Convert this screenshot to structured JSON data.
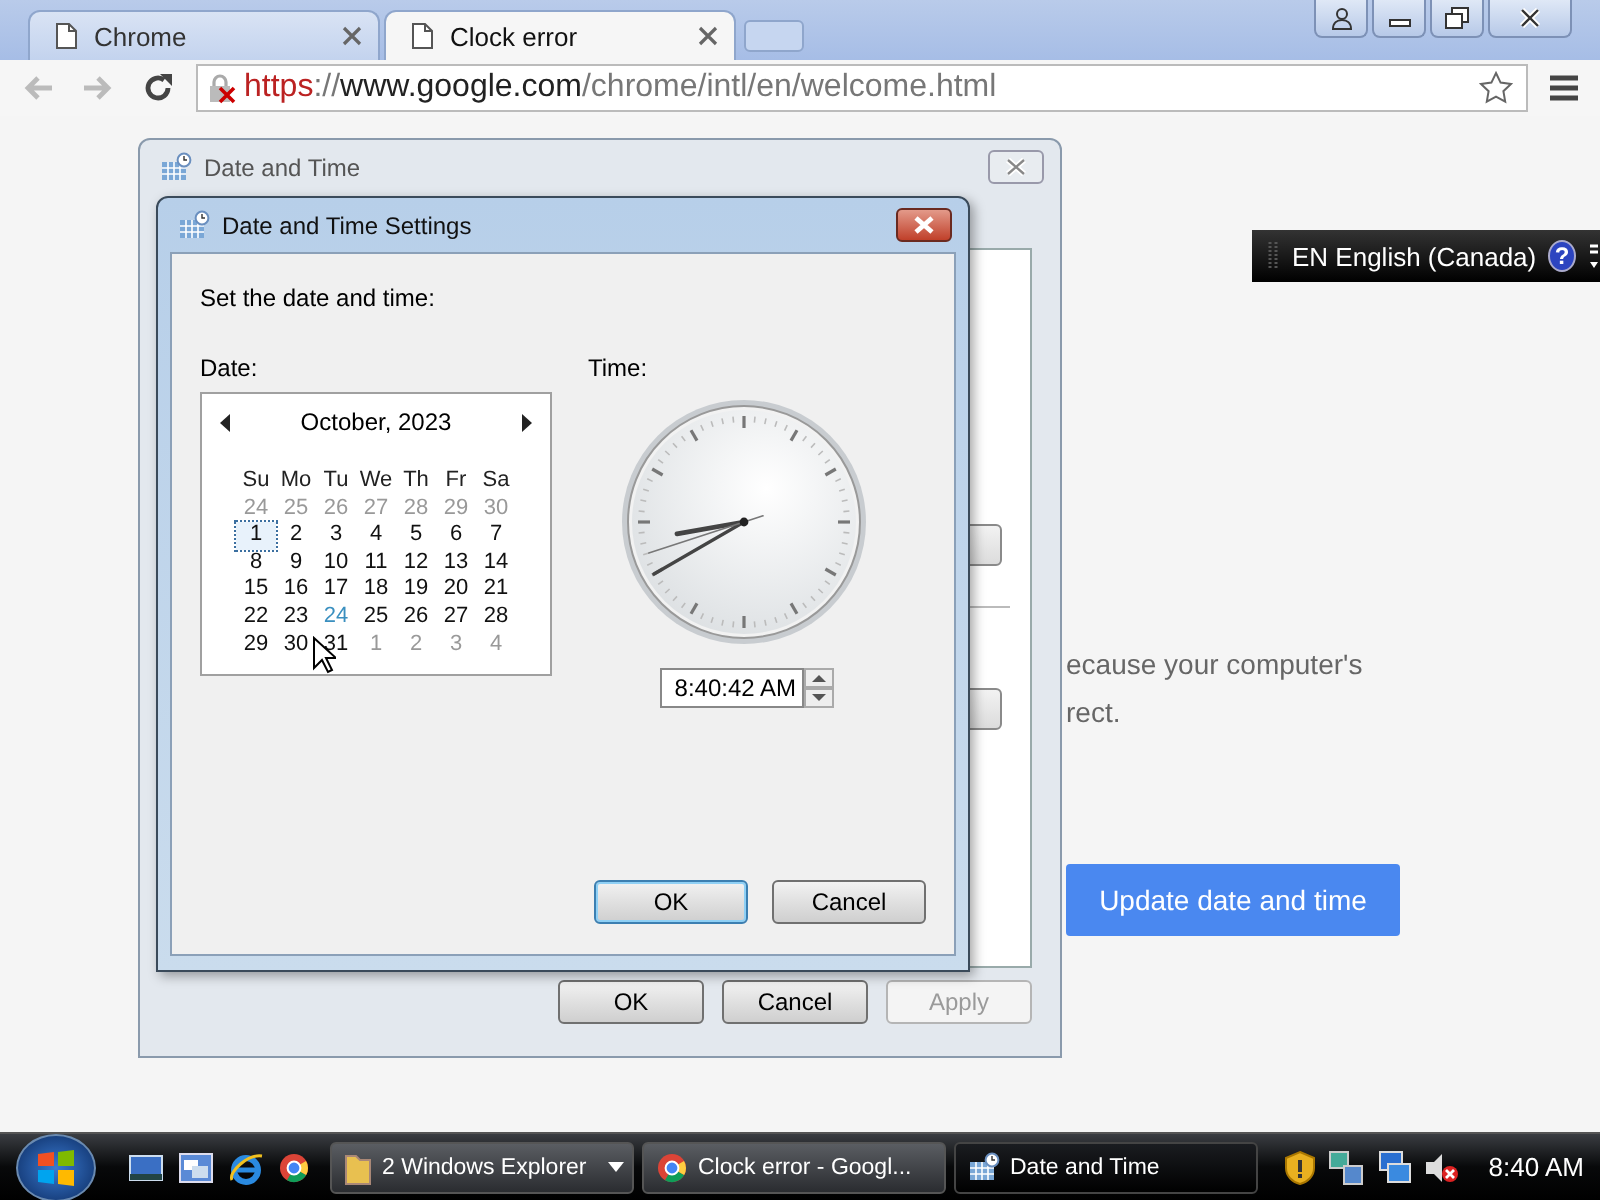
{
  "browser": {
    "tabs": [
      {
        "title": "Chrome",
        "selected": false
      },
      {
        "title": "Clock error",
        "selected": true
      }
    ],
    "address": {
      "scheme": "https",
      "separator": "://",
      "host": "www.google.com",
      "path": "/chrome/intl/en/welcome.html",
      "secure": false
    },
    "page": {
      "lines": [
        "ecause your computer's",
        "rect."
      ],
      "button": "Update date and time"
    }
  },
  "language_bar": {
    "label": "EN English (Canada)",
    "help": "?"
  },
  "date_time_window": {
    "title": "Date and Time",
    "buttons": [
      {
        "label": "OK",
        "disabled": false
      },
      {
        "label": "Cancel",
        "disabled": false
      },
      {
        "label": "Apply",
        "disabled": true
      }
    ]
  },
  "settings_dialog": {
    "title": "Date and Time Settings",
    "prompt": "Set the date and time:",
    "date_label": "Date:",
    "time_label": "Time:",
    "calendar": {
      "month": "October, 2023",
      "weekdays": [
        "Su",
        "Mo",
        "Tu",
        "We",
        "Th",
        "Fr",
        "Sa"
      ],
      "days": [
        {
          "day": "24",
          "other": true,
          "selected": false,
          "today": false
        },
        {
          "day": "25",
          "other": true,
          "selected": false,
          "today": false
        },
        {
          "day": "26",
          "other": true,
          "selected": false,
          "today": false
        },
        {
          "day": "27",
          "other": true,
          "selected": false,
          "today": false
        },
        {
          "day": "28",
          "other": true,
          "selected": false,
          "today": false
        },
        {
          "day": "29",
          "other": true,
          "selected": false,
          "today": false
        },
        {
          "day": "30",
          "other": true,
          "selected": false,
          "today": false
        },
        {
          "day": "1",
          "other": false,
          "selected": true,
          "today": false
        },
        {
          "day": "2",
          "other": false,
          "selected": false,
          "today": false
        },
        {
          "day": "3",
          "other": false,
          "selected": false,
          "today": false
        },
        {
          "day": "4",
          "other": false,
          "selected": false,
          "today": false
        },
        {
          "day": "5",
          "other": false,
          "selected": false,
          "today": false
        },
        {
          "day": "6",
          "other": false,
          "selected": false,
          "today": false
        },
        {
          "day": "7",
          "other": false,
          "selected": false,
          "today": false
        },
        {
          "day": "8",
          "other": false,
          "selected": false,
          "today": false
        },
        {
          "day": "9",
          "other": false,
          "selected": false,
          "today": false
        },
        {
          "day": "10",
          "other": false,
          "selected": false,
          "today": false
        },
        {
          "day": "11",
          "other": false,
          "selected": false,
          "today": false
        },
        {
          "day": "12",
          "other": false,
          "selected": false,
          "today": false
        },
        {
          "day": "13",
          "other": false,
          "selected": false,
          "today": false
        },
        {
          "day": "14",
          "other": false,
          "selected": false,
          "today": false
        },
        {
          "day": "15",
          "other": false,
          "selected": false,
          "today": false
        },
        {
          "day": "16",
          "other": false,
          "selected": false,
          "today": false
        },
        {
          "day": "17",
          "other": false,
          "selected": false,
          "today": false
        },
        {
          "day": "18",
          "other": false,
          "selected": false,
          "today": false
        },
        {
          "day": "19",
          "other": false,
          "selected": false,
          "today": false
        },
        {
          "day": "20",
          "other": false,
          "selected": false,
          "today": false
        },
        {
          "day": "21",
          "other": false,
          "selected": false,
          "today": false
        },
        {
          "day": "22",
          "other": false,
          "selected": false,
          "today": false
        },
        {
          "day": "23",
          "other": false,
          "selected": false,
          "today": false
        },
        {
          "day": "24",
          "other": false,
          "selected": false,
          "today": true
        },
        {
          "day": "25",
          "other": false,
          "selected": false,
          "today": false
        },
        {
          "day": "26",
          "other": false,
          "selected": false,
          "today": false
        },
        {
          "day": "27",
          "other": false,
          "selected": false,
          "today": false
        },
        {
          "day": "28",
          "other": false,
          "selected": false,
          "today": false
        },
        {
          "day": "29",
          "other": false,
          "selected": false,
          "today": false
        },
        {
          "day": "30",
          "other": false,
          "selected": false,
          "today": false
        },
        {
          "day": "31",
          "other": false,
          "selected": false,
          "today": false
        },
        {
          "day": "1",
          "other": true,
          "selected": false,
          "today": false
        },
        {
          "day": "2",
          "other": true,
          "selected": false,
          "today": false
        },
        {
          "day": "3",
          "other": true,
          "selected": false,
          "today": false
        },
        {
          "day": "4",
          "other": true,
          "selected": false,
          "today": false
        }
      ]
    },
    "time": "8:40:42 AM",
    "buttons": [
      {
        "label": "OK",
        "focused": true
      },
      {
        "label": "Cancel",
        "focused": false
      }
    ]
  },
  "taskbar": {
    "tasks": [
      {
        "label": "2 Windows Explorer",
        "kind": "group",
        "selected": false
      },
      {
        "label": "Clock error - Googl...",
        "kind": "browser",
        "selected": false
      },
      {
        "label": "Date and Time",
        "kind": "settings",
        "selected": true
      }
    ],
    "clock": "8:40 AM"
  }
}
